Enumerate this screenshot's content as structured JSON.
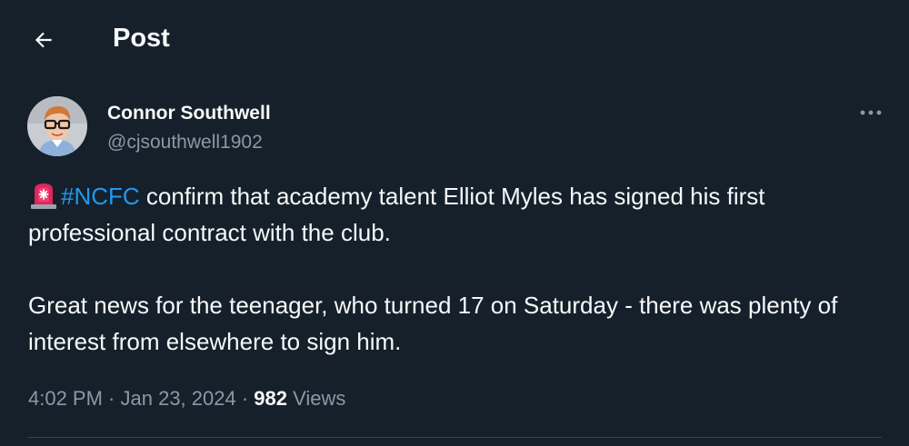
{
  "header": {
    "title": "Post"
  },
  "author": {
    "name": "Connor Southwell",
    "handle": "@cjsouthwell1902"
  },
  "post": {
    "hashtag": "#NCFC",
    "line1_rest": " confirm that academy talent Elliot Myles has signed his first professional contract with the club.",
    "paragraph2": "Great news for the teenager, who turned 17 on Saturday - there was plenty of interest from elsewhere to sign him."
  },
  "meta": {
    "time": "4:02 PM",
    "separator1": " · ",
    "date": "Jan 23, 2024",
    "separator2": " · ",
    "views_count": "982",
    "views_label": " Views"
  },
  "icons": {
    "back": "arrow-left-icon",
    "more": "more-horizontal-icon",
    "emoji": "police-car-light-icon"
  },
  "colors": {
    "background": "#15202b",
    "text_primary": "#f7f9f9",
    "text_secondary": "#8b98a5",
    "accent": "#1d9bf0",
    "divider": "#38444d"
  }
}
